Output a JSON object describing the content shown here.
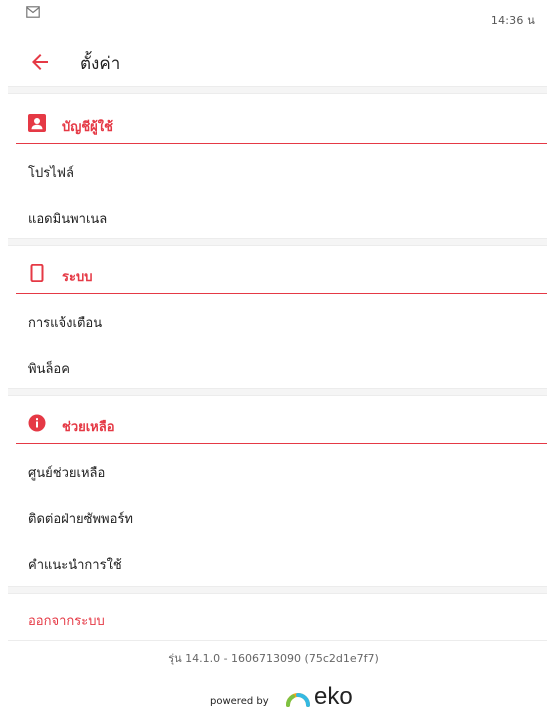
{
  "status": {
    "time": "14:36 น",
    "notification_icon": "mail-icon"
  },
  "header": {
    "title": "ตั้งค่า",
    "back_icon": "arrow-left-icon"
  },
  "sections": [
    {
      "title": "บัญชีผู้ใช้",
      "icon": "account-box-icon",
      "items": [
        {
          "label": "โปรไฟล์"
        },
        {
          "label": "แอดมินพาเนล"
        }
      ]
    },
    {
      "title": "ระบบ",
      "icon": "phone-icon",
      "items": [
        {
          "label": "การแจ้งเตือน"
        },
        {
          "label": "พินล็อค"
        }
      ]
    },
    {
      "title": "ช่วยเหลือ",
      "icon": "info-icon",
      "items": [
        {
          "label": "ศูนย์ช่วยเหลือ"
        },
        {
          "label": "ติดต่อฝ่ายซัพพอร์ท"
        },
        {
          "label": "คำแนะนำการใช้"
        }
      ]
    }
  ],
  "logout_label": "ออกจากระบบ",
  "version": "รุ่น 14.1.0 - 1606713090 (75c2d1e7f7)",
  "footer": {
    "powered_by": "powered by",
    "brand": "eko"
  },
  "colors": {
    "accent": "#e53945",
    "text": "#212121",
    "divider_bg": "#f5f5f5"
  }
}
